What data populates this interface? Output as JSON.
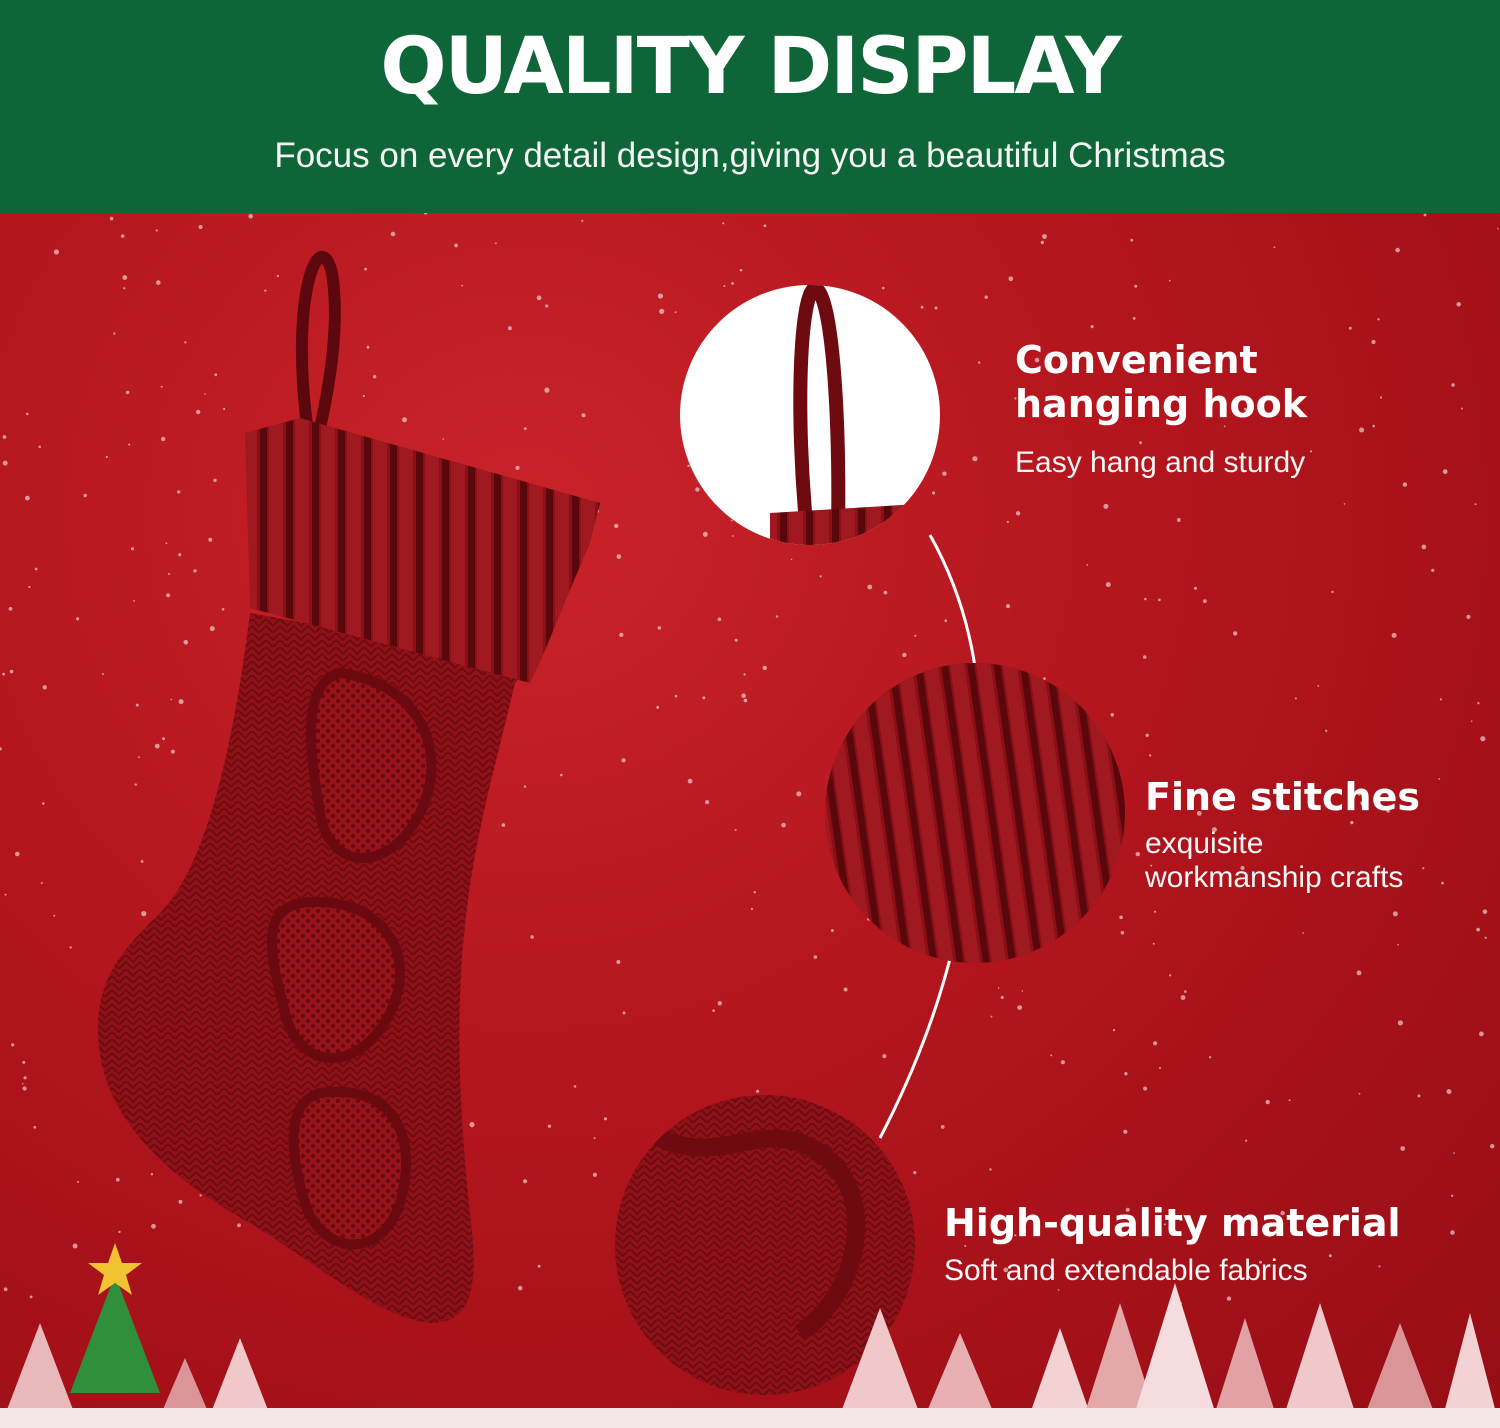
{
  "header": {
    "title": "QUALITY DISPLAY",
    "subtitle": "Focus on every detail design,giving you a beautiful Christmas"
  },
  "features": [
    {
      "title_line1": "Convenient",
      "title_line2": "hanging hook",
      "desc": "Easy hang and sturdy"
    },
    {
      "title_line1": "Fine stitches",
      "desc_line1": "exquisite",
      "desc_line2": "workmanship crafts"
    },
    {
      "title_line1": "High-quality material",
      "desc": "Soft and extendable fabrics"
    }
  ],
  "colors": {
    "header_green": "#0e6638",
    "background_red": "#b3151d",
    "stocking_red": "#8e1118"
  },
  "icons": {
    "product": "knit-christmas-stocking",
    "tree": "christmas-tree-icon",
    "star": "star-icon"
  }
}
